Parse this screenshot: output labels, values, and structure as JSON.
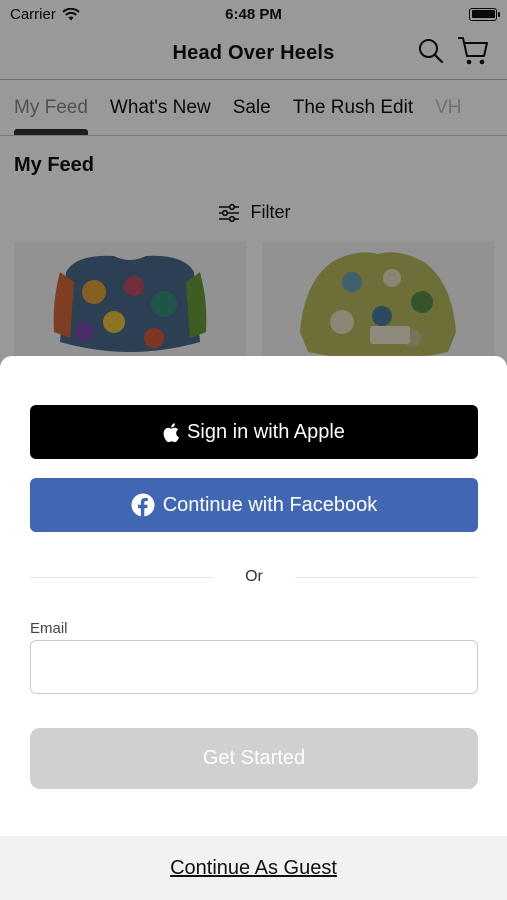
{
  "status_bar": {
    "carrier": "Carrier",
    "time": "6:48 PM"
  },
  "header": {
    "title": "Head Over Heels"
  },
  "tabs": [
    {
      "label": "My Feed"
    },
    {
      "label": "What's New"
    },
    {
      "label": "Sale"
    },
    {
      "label": "The Rush Edit"
    },
    {
      "label": "VH"
    }
  ],
  "feed": {
    "title": "My Feed",
    "filter_label": "Filter"
  },
  "sheet": {
    "apple_label": "Sign in with Apple",
    "facebook_label": "Continue with Facebook",
    "divider_text": "Or",
    "email_label": "Email",
    "email_value": "",
    "get_started_label": "Get Started",
    "guest_label": "Continue As Guest"
  },
  "colors": {
    "facebook": "#4267b2",
    "apple": "#000000",
    "disabled_button": "#d0d0d0"
  }
}
